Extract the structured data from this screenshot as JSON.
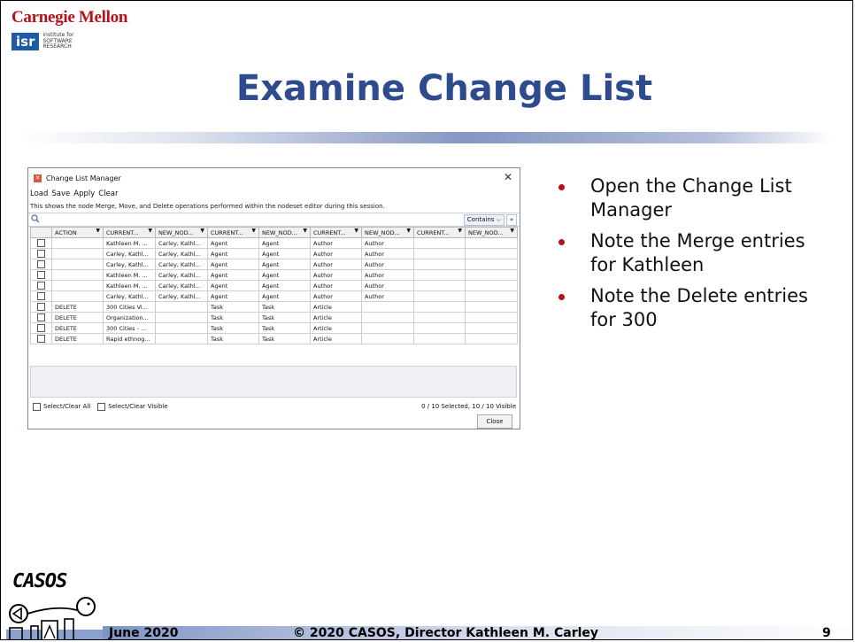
{
  "header": {
    "org_name": "Carnegie Mellon",
    "isr_logo": "isr",
    "isr_caption_line1": "institute for",
    "isr_caption_line2": "SOFTWARE",
    "isr_caption_line3": "RESEARCH"
  },
  "slide": {
    "title": "Examine Change List",
    "title_color": "#2e4b8e",
    "accent_color": "#b5121b"
  },
  "dialog": {
    "title": "Change List Manager",
    "menu": [
      "Load",
      "Save",
      "Apply",
      "Clear"
    ],
    "info": "This shows the node Merge, Move, and Delete operations performed within the nodeset editor during this session.",
    "filter_mode": "Contains",
    "columns": [
      "",
      "ACTION",
      "CURRENT...",
      "NEW_NOD...",
      "CURRENT...",
      "NEW_NOD...",
      "CURRENT...",
      "NEW_NOD...",
      "CURRENT...",
      "NEW_NOD..."
    ],
    "rows": [
      [
        "",
        "Kathleen M. ...",
        "Carley, Kathl...",
        "Agent",
        "Agent",
        "Author",
        "Author",
        "",
        ""
      ],
      [
        "",
        "Carley, Kathl...",
        "Carley, Kathl...",
        "Agent",
        "Agent",
        "Author",
        "Author",
        "",
        ""
      ],
      [
        "",
        "Carley, Kathl...",
        "Carley, Kathl...",
        "Agent",
        "Agent",
        "Author",
        "Author",
        "",
        ""
      ],
      [
        "",
        "Kathleen M. ...",
        "Carley, Kathl...",
        "Agent",
        "Agent",
        "Author",
        "Author",
        "",
        ""
      ],
      [
        "",
        "Kathleen M. ...",
        "Carley, Kathl...",
        "Agent",
        "Agent",
        "Author",
        "Author",
        "",
        ""
      ],
      [
        "",
        "Carley, Kathl...",
        "Carley, Kathl...",
        "Agent",
        "Agent",
        "Author",
        "Author",
        "",
        ""
      ],
      [
        "DELETE",
        "300 Cities Vi...",
        "",
        "Task",
        "Task",
        "Article",
        "",
        "",
        ""
      ],
      [
        "DELETE",
        "Organization...",
        "",
        "Task",
        "Task",
        "Article",
        "",
        "",
        ""
      ],
      [
        "DELETE",
        "300 Cities - ...",
        "",
        "Task",
        "Task",
        "Article",
        "",
        "",
        ""
      ],
      [
        "DELETE",
        "Rapid ethnog...",
        "",
        "Task",
        "Task",
        "Article",
        "",
        "",
        ""
      ]
    ],
    "select_all_label": "Select/Clear All",
    "select_visible_label": "Select/Clear Visible",
    "selection_status": "0 / 10 Selected, 10 / 10 Visible",
    "close_label": "Close"
  },
  "bullets": [
    "Open the Change List Manager",
    "Note the Merge entries for Kathleen",
    "Note the Delete entries for 300"
  ],
  "footer": {
    "logo_text": "CASOS",
    "date": "June 2020",
    "copyright": "© 2020 CASOS, Director Kathleen M. Carley",
    "page_number": "9"
  }
}
